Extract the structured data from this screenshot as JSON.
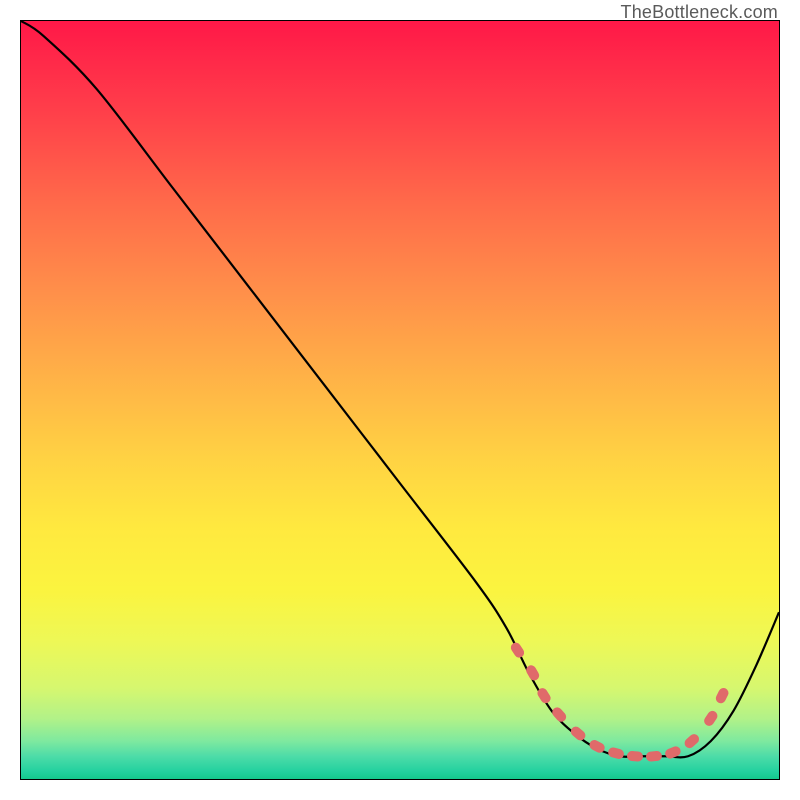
{
  "attribution": "TheBottleneck.com",
  "chart_data": {
    "type": "line",
    "title": "",
    "xlabel": "",
    "ylabel": "",
    "xlim": [
      0,
      100
    ],
    "ylim": [
      0,
      100
    ],
    "x": [
      0,
      3,
      10,
      20,
      30,
      40,
      50,
      60,
      64,
      67,
      70,
      73,
      76,
      79,
      82,
      85,
      88,
      91,
      94,
      97,
      100
    ],
    "values": [
      100,
      98,
      91,
      78,
      65,
      52,
      39,
      26,
      20,
      14,
      9,
      6,
      4,
      3,
      3,
      3,
      3,
      5,
      9,
      15,
      22
    ],
    "markers": [
      {
        "x": 65.5,
        "y": 17
      },
      {
        "x": 67.5,
        "y": 14
      },
      {
        "x": 69,
        "y": 11
      },
      {
        "x": 71,
        "y": 8.5
      },
      {
        "x": 73.5,
        "y": 6
      },
      {
        "x": 76,
        "y": 4.3
      },
      {
        "x": 78.5,
        "y": 3.4
      },
      {
        "x": 81,
        "y": 3
      },
      {
        "x": 83.5,
        "y": 3
      },
      {
        "x": 86,
        "y": 3.5
      },
      {
        "x": 88.5,
        "y": 5
      },
      {
        "x": 91,
        "y": 8
      },
      {
        "x": 92.5,
        "y": 11
      }
    ]
  }
}
